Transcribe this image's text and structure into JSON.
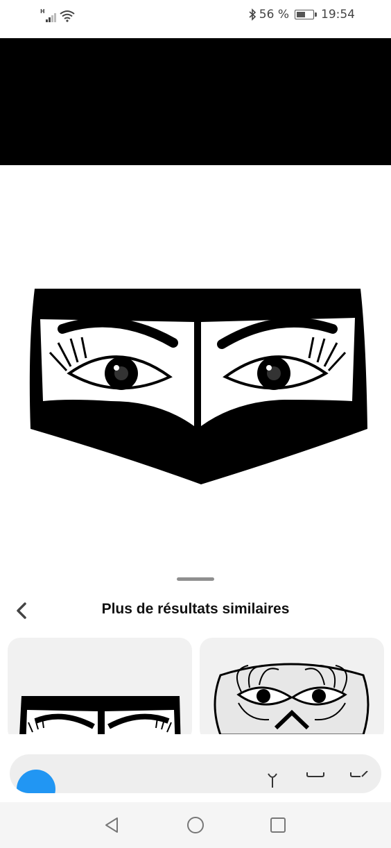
{
  "status_bar": {
    "network_type": "H",
    "battery_percent": "56 %",
    "time": "19:54",
    "icons": [
      "signal-icon",
      "wifi-icon",
      "bluetooth-icon",
      "battery-icon"
    ],
    "battery_level": 0.56
  },
  "hero_image": {
    "subject": "eyes-veil-illustration-icon"
  },
  "sheet": {
    "title": "Plus de résultats similaires",
    "back_icon": "chevron-left-icon"
  },
  "results": [
    {
      "thumbnail": "eyes-veil-illustration-icon"
    },
    {
      "thumbnail": "eye-mask-lashes-icon"
    }
  ],
  "search_bar": {
    "icons": [
      "search-icon",
      "microphone-icon",
      "camera-icon",
      "edit-icon"
    ]
  },
  "nav_bar": {
    "icons": [
      "back-triangle-icon",
      "home-circle-icon",
      "recents-square-icon"
    ]
  },
  "colors": {
    "accent": "#2196f3",
    "background": "#ffffff",
    "ink": "#000000"
  }
}
